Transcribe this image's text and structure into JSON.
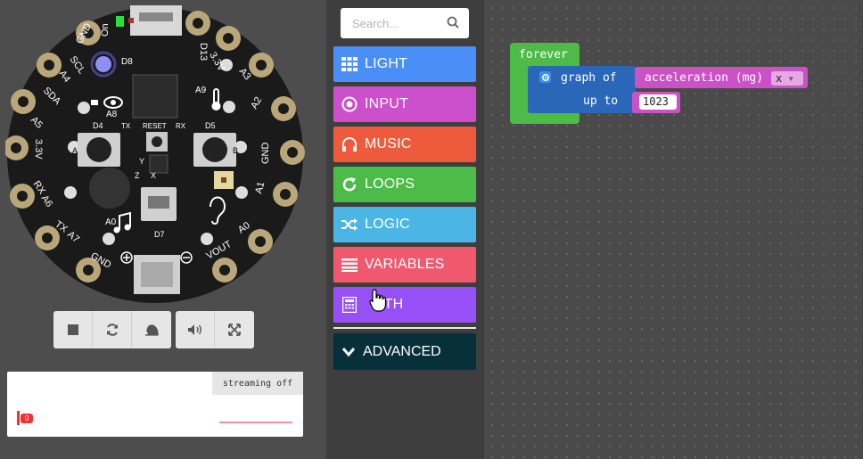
{
  "colors": {
    "light": "#4a8ff7",
    "input": "#cc4fcc",
    "music": "#ee5a3c",
    "loops": "#4cbb47",
    "logic": "#4bb6e6",
    "variables": "#f0586d",
    "math": "#9650f5",
    "advanced": "#08303a",
    "board": "#1a1a1a",
    "pad_gold": "#b9a77a"
  },
  "board": {
    "labels": {
      "gnd_top": "GND",
      "on": "On",
      "d13": "D13",
      "d8": "D8",
      "scl": "SCL",
      "a4": "A4",
      "v33_top": "3.3V",
      "a3": "A3",
      "sda": "SDA",
      "a5_left": "A5",
      "a9": "A9",
      "a2": "A2",
      "a8": "A8",
      "d4": "D4",
      "tx_small": "TX",
      "reset": "RESET",
      "rx_small": "RX",
      "d5": "D5",
      "v33_left": "3.3V",
      "gnd_right": "GND",
      "rx_left": "RX",
      "a6": "A6",
      "a1": "A1",
      "y_axis": "Y",
      "x_axis": "X",
      "z_axis": "Z",
      "tx_left": "TX",
      "a7": "A7",
      "a0_left": "A0",
      "a0_right": "A0",
      "d7": "D7",
      "gnd_bottom": "GND",
      "vout": "VOUT",
      "btn_a": "A",
      "btn_b": "B"
    },
    "icons": [
      "eye-icon",
      "thermometer-icon",
      "music-note-icon",
      "ear-icon",
      "plus-icon",
      "minus-icon"
    ]
  },
  "sim_toolbar": {
    "buttons": [
      "stop-icon",
      "restart-icon",
      "slow-motion-icon",
      "sound-icon",
      "fullscreen-icon"
    ]
  },
  "console": {
    "streaming_label": "streaming off",
    "value_badge": "0"
  },
  "toolbox": {
    "search_placeholder": "Search...",
    "categories": [
      {
        "label": "LIGHT",
        "icon": "grid-icon"
      },
      {
        "label": "INPUT",
        "icon": "target-icon"
      },
      {
        "label": "MUSIC",
        "icon": "headphones-icon"
      },
      {
        "label": "LOOPS",
        "icon": "refresh-icon"
      },
      {
        "label": "LOGIC",
        "icon": "shuffle-icon"
      },
      {
        "label": "VARIABLES",
        "icon": "list-icon"
      },
      {
        "label": "ATH",
        "icon": "calculator-icon"
      }
    ],
    "advanced_label": "ADVANCED"
  },
  "workspace": {
    "forever_label": "forever",
    "graph_label": "graph of",
    "upto_label": "up to",
    "accel_label": "acceleration (mg)",
    "axis_value": "x",
    "upto_value": "1023"
  }
}
